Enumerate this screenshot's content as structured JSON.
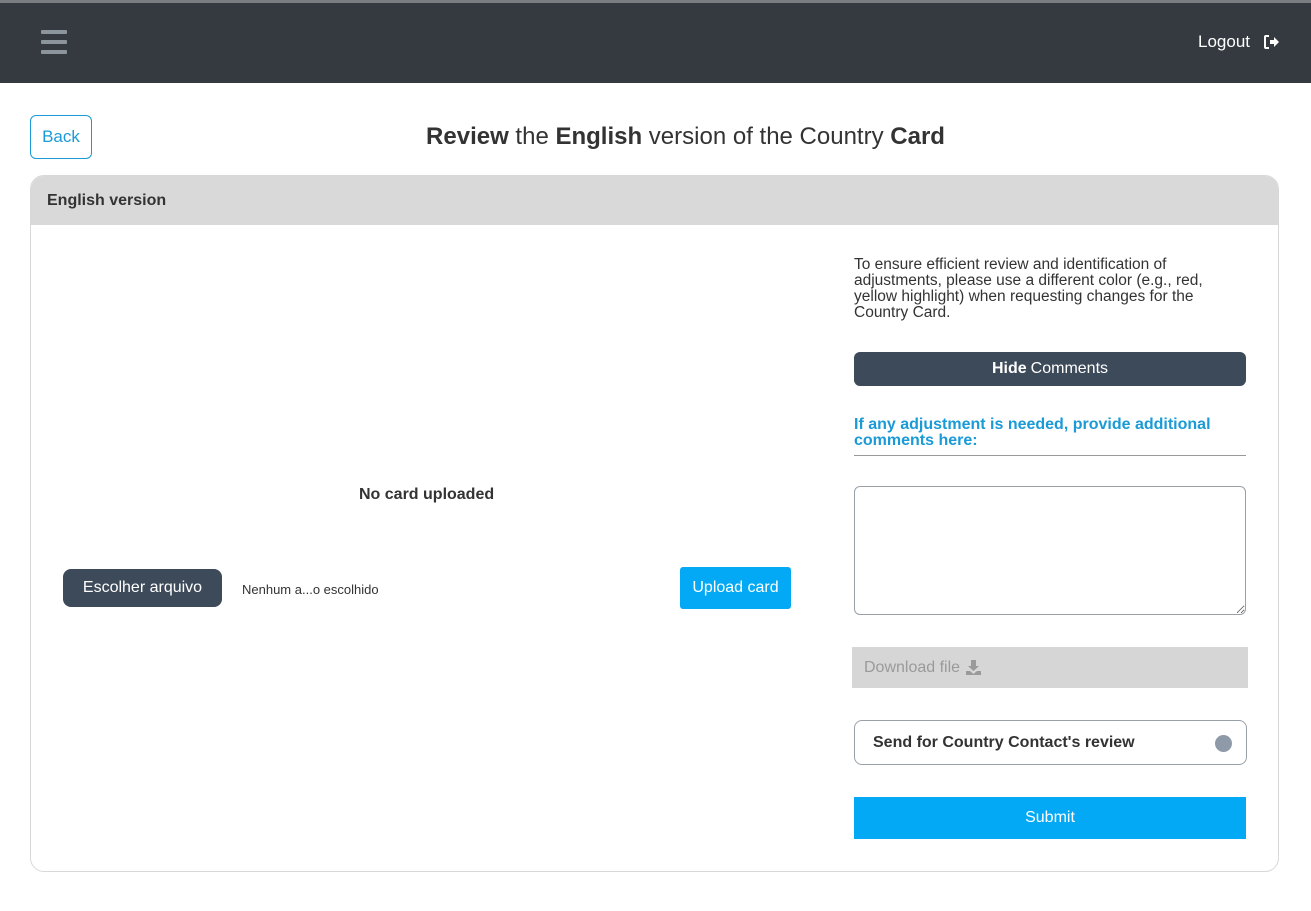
{
  "navbar": {
    "menu_icon": "hamburger-menu-icon",
    "logout_label": "Logout",
    "logout_icon": "sign-out-icon"
  },
  "page": {
    "back_label": "Back",
    "title_parts": [
      "Review",
      " the ",
      "English",
      " version of the Country ",
      "Card"
    ]
  },
  "card": {
    "header": "English version",
    "no_card_text": "No card uploaded",
    "choose_file_label": "Escolher arquivo",
    "file_name_text": "Nenhum a...o escolhido",
    "upload_label": "Upload card",
    "instructions": "To ensure efficient review and identification of adjustments, please use a different color (e.g., red, yellow highlight) when requesting changes for the Country Card.",
    "hide_bold": "Hide",
    "hide_rest": "Comments",
    "adjustment_label": "If any adjustment is needed, provide additional comments here:",
    "comments_value": "",
    "download_label": "Download file",
    "download_icon": "download-icon",
    "send_review_label": "Send for Country Contact's review",
    "send_review_on": false,
    "submit_label": "Submit"
  },
  "colors": {
    "navbar": "#343a40",
    "accent": "#03a9f4",
    "link": "#1a9ad6",
    "dark_button": "#3d4a5a"
  }
}
